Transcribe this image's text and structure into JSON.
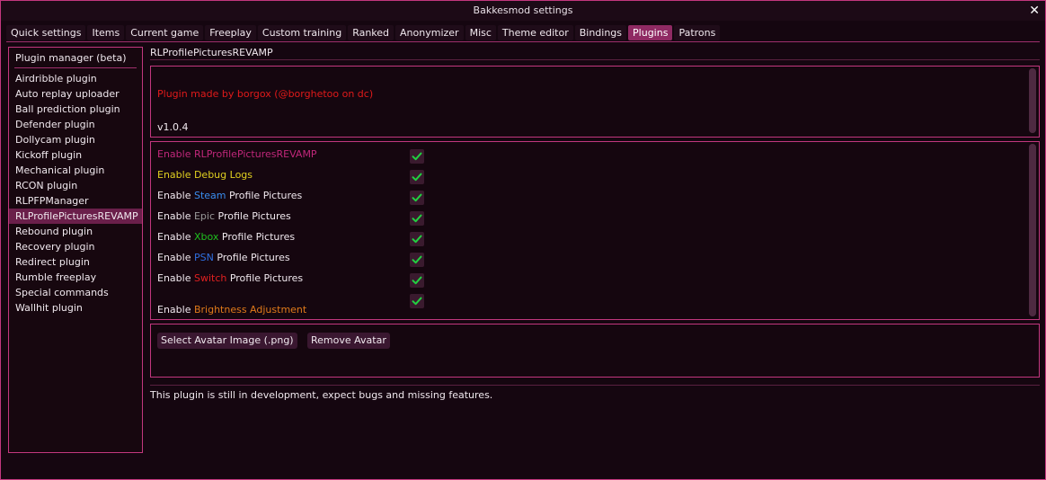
{
  "window": {
    "title": "Bakkesmod settings",
    "close_label": "✕"
  },
  "tabs": [
    {
      "label": "Quick settings"
    },
    {
      "label": "Items"
    },
    {
      "label": "Current game"
    },
    {
      "label": "Freeplay"
    },
    {
      "label": "Custom training"
    },
    {
      "label": "Ranked"
    },
    {
      "label": "Anonymizer"
    },
    {
      "label": "Misc"
    },
    {
      "label": "Theme editor"
    },
    {
      "label": "Bindings"
    },
    {
      "label": "Plugins"
    },
    {
      "label": "Patrons"
    }
  ],
  "active_tab": "Plugins",
  "sidebar": {
    "header": "Plugin manager (beta)",
    "items": [
      {
        "label": "Airdribble plugin"
      },
      {
        "label": "Auto replay uploader"
      },
      {
        "label": "Ball prediction plugin"
      },
      {
        "label": "Defender plugin"
      },
      {
        "label": "Dollycam plugin"
      },
      {
        "label": "Kickoff plugin"
      },
      {
        "label": "Mechanical plugin"
      },
      {
        "label": "RCON plugin"
      },
      {
        "label": "RLPFPManager"
      },
      {
        "label": "RLProfilePicturesREVAMP"
      },
      {
        "label": "Rebound plugin"
      },
      {
        "label": "Recovery plugin"
      },
      {
        "label": "Redirect plugin"
      },
      {
        "label": "Rumble freeplay"
      },
      {
        "label": "Special commands"
      },
      {
        "label": "Wallhit plugin"
      }
    ],
    "selected": "RLProfilePicturesREVAMP"
  },
  "plugin": {
    "title": "RLProfilePicturesREVAMP",
    "credit": "Plugin made by borgox (@borghetoo on dc)",
    "version": "v1.0.4",
    "options": [
      {
        "parts": [
          {
            "text": "Enable RLProfilePicturesREVAMP",
            "color": "#c0277a"
          }
        ],
        "checked": true
      },
      {
        "parts": [
          {
            "text": "Enable Debug Logs",
            "color": "#e0d020"
          }
        ],
        "checked": true
      },
      {
        "parts": [
          {
            "text": "Enable ",
            "color": "#f0e8ee"
          },
          {
            "text": "Steam",
            "color": "#3a8ef0"
          },
          {
            "text": " Profile Pictures",
            "color": "#f0e8ee"
          }
        ],
        "checked": true
      },
      {
        "parts": [
          {
            "text": "Enable ",
            "color": "#f0e8ee"
          },
          {
            "text": "Epic",
            "color": "#9a9a9a"
          },
          {
            "text": " Profile Pictures",
            "color": "#f0e8ee"
          }
        ],
        "checked": true
      },
      {
        "parts": [
          {
            "text": "Enable ",
            "color": "#f0e8ee"
          },
          {
            "text": "Xbox",
            "color": "#1fc01f"
          },
          {
            "text": " Profile Pictures",
            "color": "#f0e8ee"
          }
        ],
        "checked": true
      },
      {
        "parts": [
          {
            "text": "Enable ",
            "color": "#f0e8ee"
          },
          {
            "text": "PSN",
            "color": "#2f6fe0"
          },
          {
            "text": " Profile Pictures",
            "color": "#f0e8ee"
          }
        ],
        "checked": true
      },
      {
        "parts": [
          {
            "text": "Enable ",
            "color": "#f0e8ee"
          },
          {
            "text": "Switch",
            "color": "#e02020"
          },
          {
            "text": " Profile Pictures",
            "color": "#f0e8ee"
          }
        ],
        "checked": true
      },
      {
        "parts": [
          {
            "text": "Enable ",
            "color": "#f0e8ee"
          },
          {
            "text": "Brightness Adjustment",
            "color": "#e07a1a"
          }
        ],
        "checked": true
      }
    ],
    "buttons": {
      "select_avatar": "Select Avatar Image (.png)",
      "remove_avatar": "Remove Avatar"
    },
    "dev_note": "This plugin is still in development, expect bugs and missing features."
  },
  "colors": {
    "accent": "#c2377e",
    "check": "#22d040",
    "active_tab": "#8f2a63"
  }
}
